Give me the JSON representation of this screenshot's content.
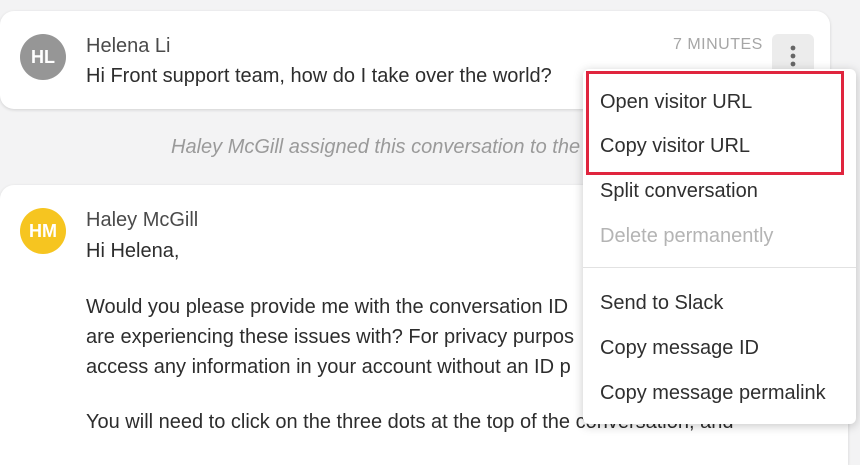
{
  "message1": {
    "avatar_initials": "HL",
    "avatar_color": "#969696",
    "sender": "Helena Li",
    "text": "Hi Front support team, how do I take over the world?",
    "time": "7 MINUTES",
    "more_icon": "vertical-dots-icon"
  },
  "event": {
    "text": "Haley McGill assigned this conversation to the"
  },
  "message2": {
    "avatar_initials": "HM",
    "avatar_color": "#f6c520",
    "sender": "Haley McGill",
    "lines": [
      "Hi Helena,",
      "Would you please provide me with the conversation ID",
      "are experiencing these issues with? For privacy purpos",
      "access any information in your account without an ID p",
      "You will need to click on the three dots at the top of the conversation, and"
    ]
  },
  "menu": {
    "items": [
      {
        "label": "Open visitor URL",
        "disabled": false
      },
      {
        "label": "Copy visitor URL",
        "disabled": false
      },
      {
        "label": "Split conversation",
        "disabled": false
      },
      {
        "label": "Delete permanently",
        "disabled": true
      },
      {
        "label": "Send to Slack",
        "disabled": false
      },
      {
        "label": "Copy message ID",
        "disabled": false
      },
      {
        "label": "Copy message permalink",
        "disabled": false
      }
    ],
    "highlight_color": "#e0253e"
  }
}
